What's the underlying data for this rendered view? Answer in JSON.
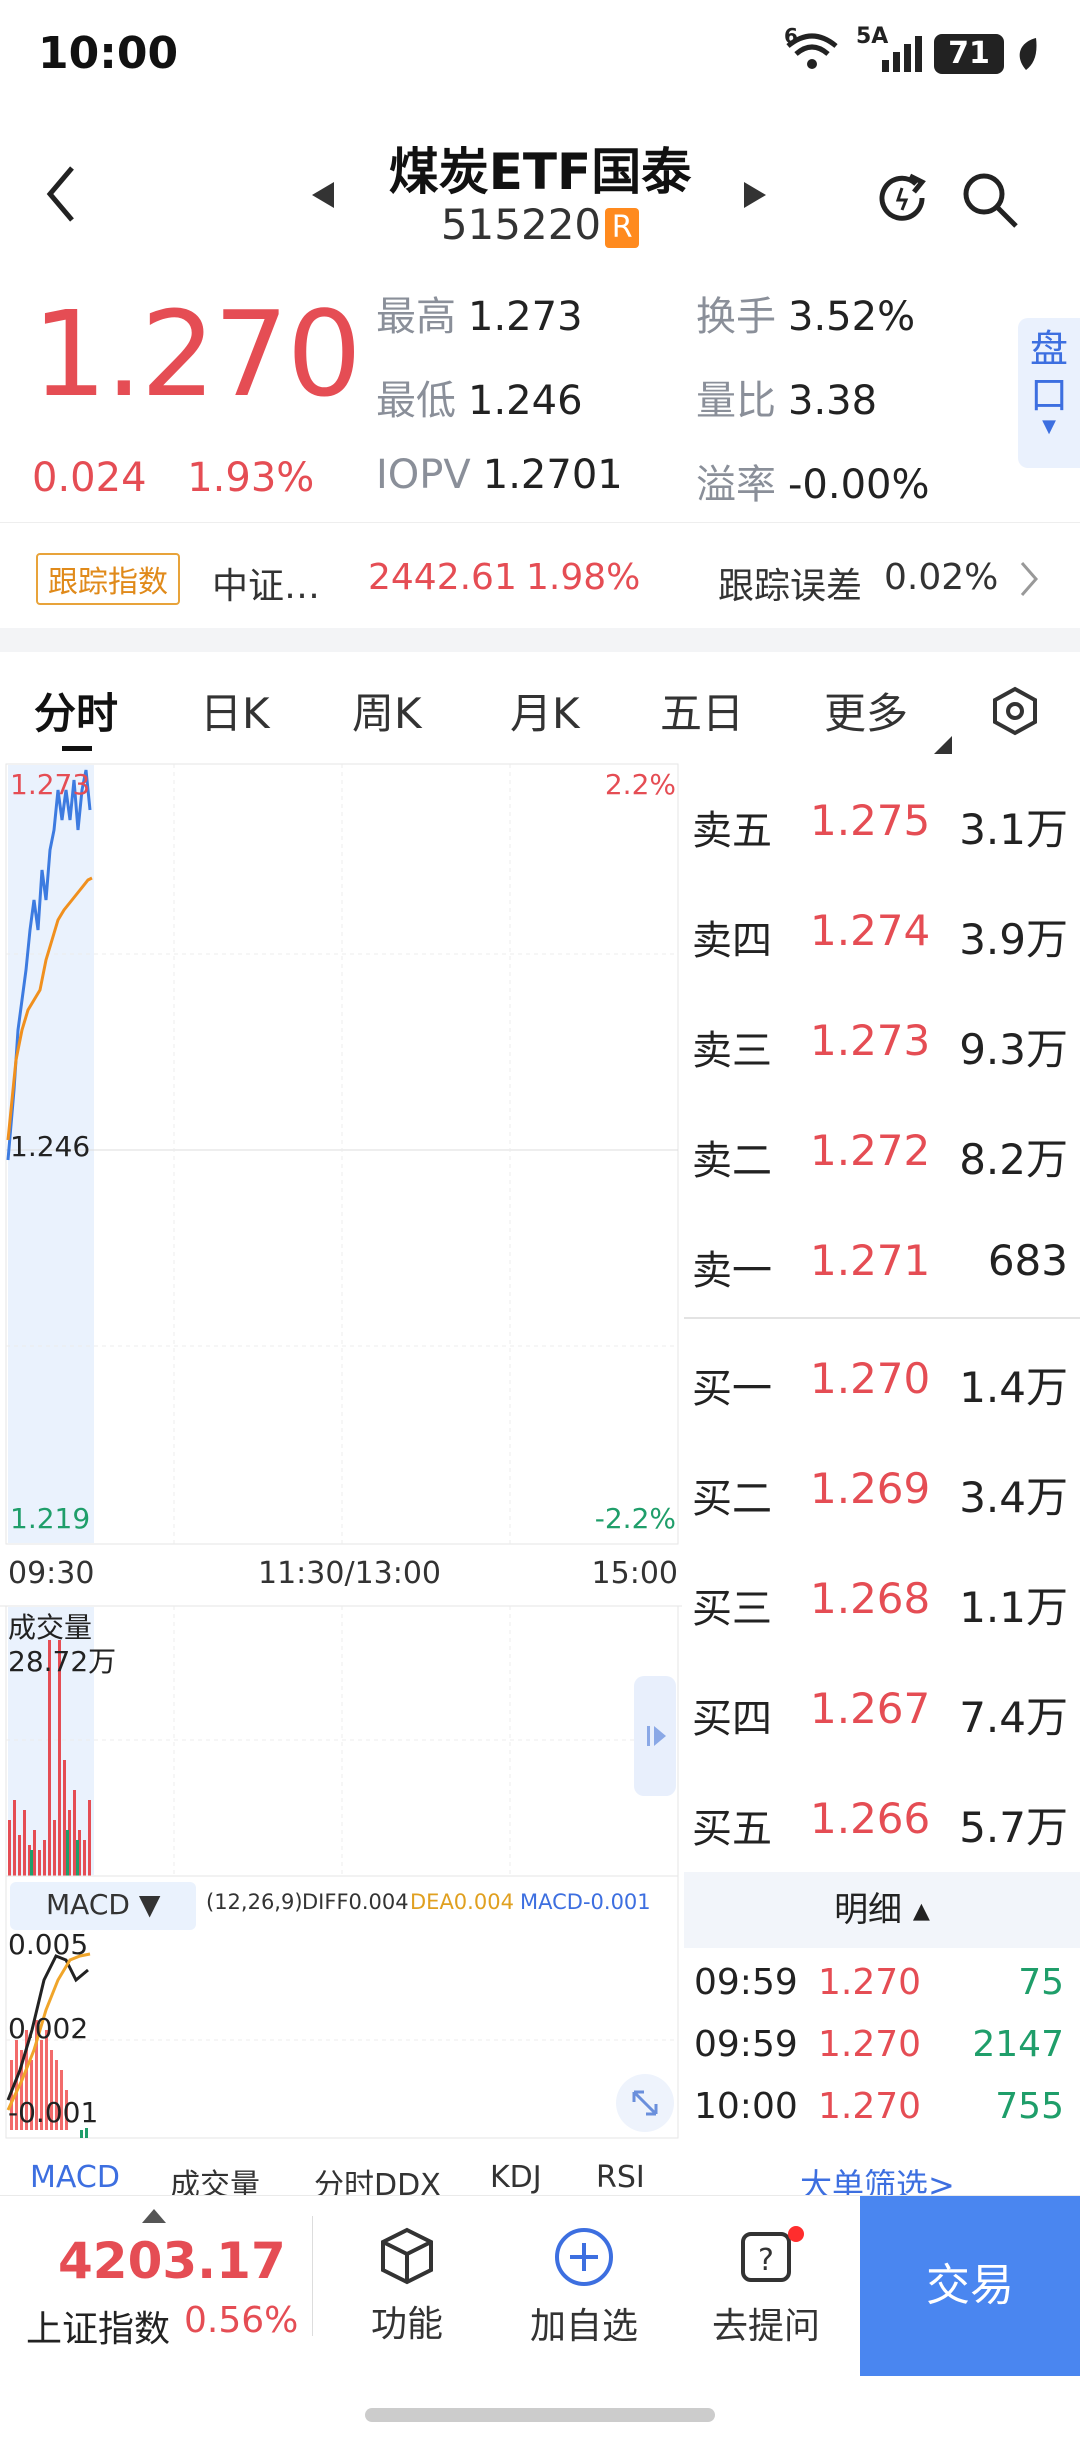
{
  "status": {
    "time": "10:00",
    "net1": "6",
    "net2": "5A",
    "battery": "71"
  },
  "header": {
    "title": "煤炭ETF国泰",
    "code": "515220",
    "badge": "R"
  },
  "quote": {
    "price": "1.270",
    "change": "0.024",
    "change_pct": "1.93%",
    "stats": [
      {
        "k": "最高",
        "v": "1.273"
      },
      {
        "k": "换手",
        "v": "3.52%"
      },
      {
        "k": "最低",
        "v": "1.246"
      },
      {
        "k": "量比",
        "v": "3.38"
      },
      {
        "k": "IOPV",
        "v": "1.2701"
      },
      {
        "k": "溢率",
        "v": "-0.00%"
      }
    ],
    "pankou": "盘口"
  },
  "tracking": {
    "tag": "跟踪指数",
    "name": "中证…",
    "value": "2442.61",
    "pct": "1.98%",
    "error_label": "跟踪误差",
    "error": "0.02%"
  },
  "tabs": [
    "分时",
    "日K",
    "周K",
    "月K",
    "五日",
    "更多"
  ],
  "chart": {
    "y_top": "1.273",
    "y_mid": "1.246",
    "y_bot": "1.219",
    "pct_top": "2.2%",
    "pct_bot": "-2.2%",
    "t_start": "09:30",
    "t_mid": "11:30/13:00",
    "t_end": "15:00",
    "vol_label": "成交量",
    "vol_value": "28.72万",
    "macd_label": "MACD ▼",
    "macd_params": "(12,26,9)",
    "diff": "DIFF0.004",
    "dea": "DEA0.004",
    "macd": "MACD-0.001",
    "macd_y1": "0.005",
    "macd_y2": "0.002",
    "macd_y3": "-0.001"
  },
  "orderbook": [
    {
      "label": "卖五",
      "price": "1.275",
      "vol": "3.1万"
    },
    {
      "label": "卖四",
      "price": "1.274",
      "vol": "3.9万"
    },
    {
      "label": "卖三",
      "price": "1.273",
      "vol": "9.3万"
    },
    {
      "label": "卖二",
      "price": "1.272",
      "vol": "8.2万"
    },
    {
      "label": "卖一",
      "price": "1.271",
      "vol": "683"
    },
    {
      "label": "买一",
      "price": "1.270",
      "vol": "1.4万"
    },
    {
      "label": "买二",
      "price": "1.269",
      "vol": "3.4万"
    },
    {
      "label": "买三",
      "price": "1.268",
      "vol": "1.1万"
    },
    {
      "label": "买四",
      "price": "1.267",
      "vol": "7.4万"
    },
    {
      "label": "买五",
      "price": "1.266",
      "vol": "5.7万"
    }
  ],
  "details": {
    "title": "明细 ▴",
    "rows": [
      {
        "t": "09:59",
        "p": "1.270",
        "v": "75"
      },
      {
        "t": "09:59",
        "p": "1.270",
        "v": "2147"
      },
      {
        "t": "10:00",
        "p": "1.270",
        "v": "755"
      }
    ],
    "filter": "大单筛选>"
  },
  "indicator_tabs": [
    "MACD",
    "成交量",
    "分时DDX",
    "KDJ",
    "RSI"
  ],
  "bottom": {
    "index_value": "4203.17",
    "index_name": "上证指数",
    "index_pct": "0.56%",
    "func": "功能",
    "add": "加自选",
    "ask": "去提问",
    "trade": "交易"
  }
}
